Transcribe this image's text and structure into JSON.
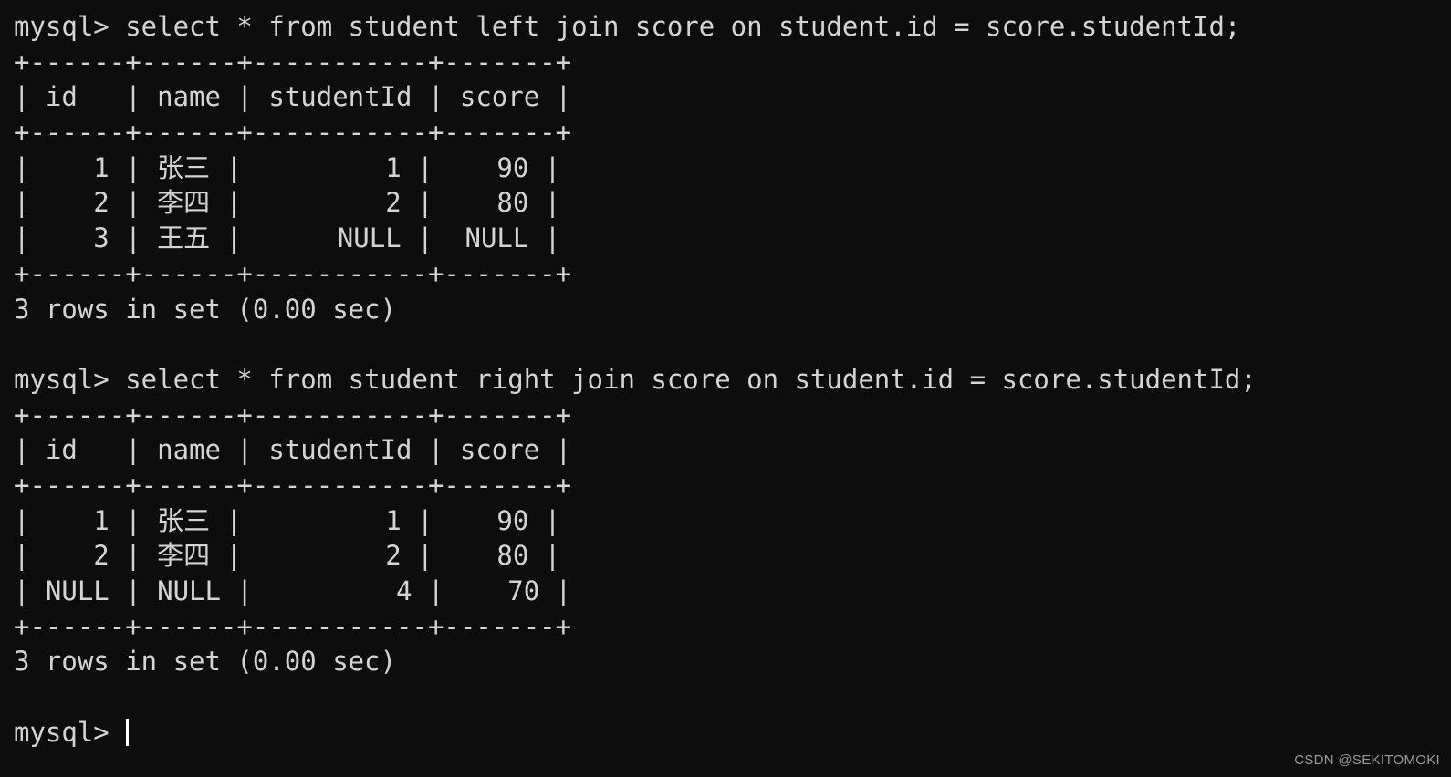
{
  "terminal": {
    "background_color": "#0d0d0d",
    "text_color": "#d4d4d4",
    "prompt": "mysql> ",
    "blocks": [
      {
        "command": "mysql> select * from student left join score on student.id = score.studentId;",
        "separator": "+------+------+-----------+-------+",
        "header": "| id   | name | studentId | score |",
        "rows": [
          "|    1 | 张三 |         1 |    90 |",
          "|    2 | 李四 |         2 |    80 |",
          "|    3 | 王五 |      NULL |  NULL |"
        ],
        "footer": "3 rows in set (0.00 sec)"
      },
      {
        "command": "mysql> select * from student right join score on student.id = score.studentId;",
        "separator": "+------+------+-----------+-------+",
        "header": "| id   | name | studentId | score |",
        "rows": [
          "|    1 | 张三 |         1 |    90 |",
          "|    2 | 李四 |         2 |    80 |",
          "| NULL | NULL |         4 |    70 |"
        ],
        "footer": "3 rows in set (0.00 sec)"
      }
    ],
    "final_prompt": "mysql> "
  },
  "watermark": {
    "text": "CSDN @SEKITOMOKI"
  },
  "table_data": {
    "columns": [
      "id",
      "name",
      "studentId",
      "score"
    ],
    "left_join_result": [
      {
        "id": "1",
        "name": "张三",
        "studentId": "1",
        "score": "90"
      },
      {
        "id": "2",
        "name": "李四",
        "studentId": "2",
        "score": "80"
      },
      {
        "id": "3",
        "name": "王五",
        "studentId": "NULL",
        "score": "NULL"
      }
    ],
    "right_join_result": [
      {
        "id": "1",
        "name": "张三",
        "studentId": "1",
        "score": "90"
      },
      {
        "id": "2",
        "name": "李四",
        "studentId": "2",
        "score": "80"
      },
      {
        "id": "NULL",
        "name": "NULL",
        "studentId": "4",
        "score": "70"
      }
    ]
  }
}
